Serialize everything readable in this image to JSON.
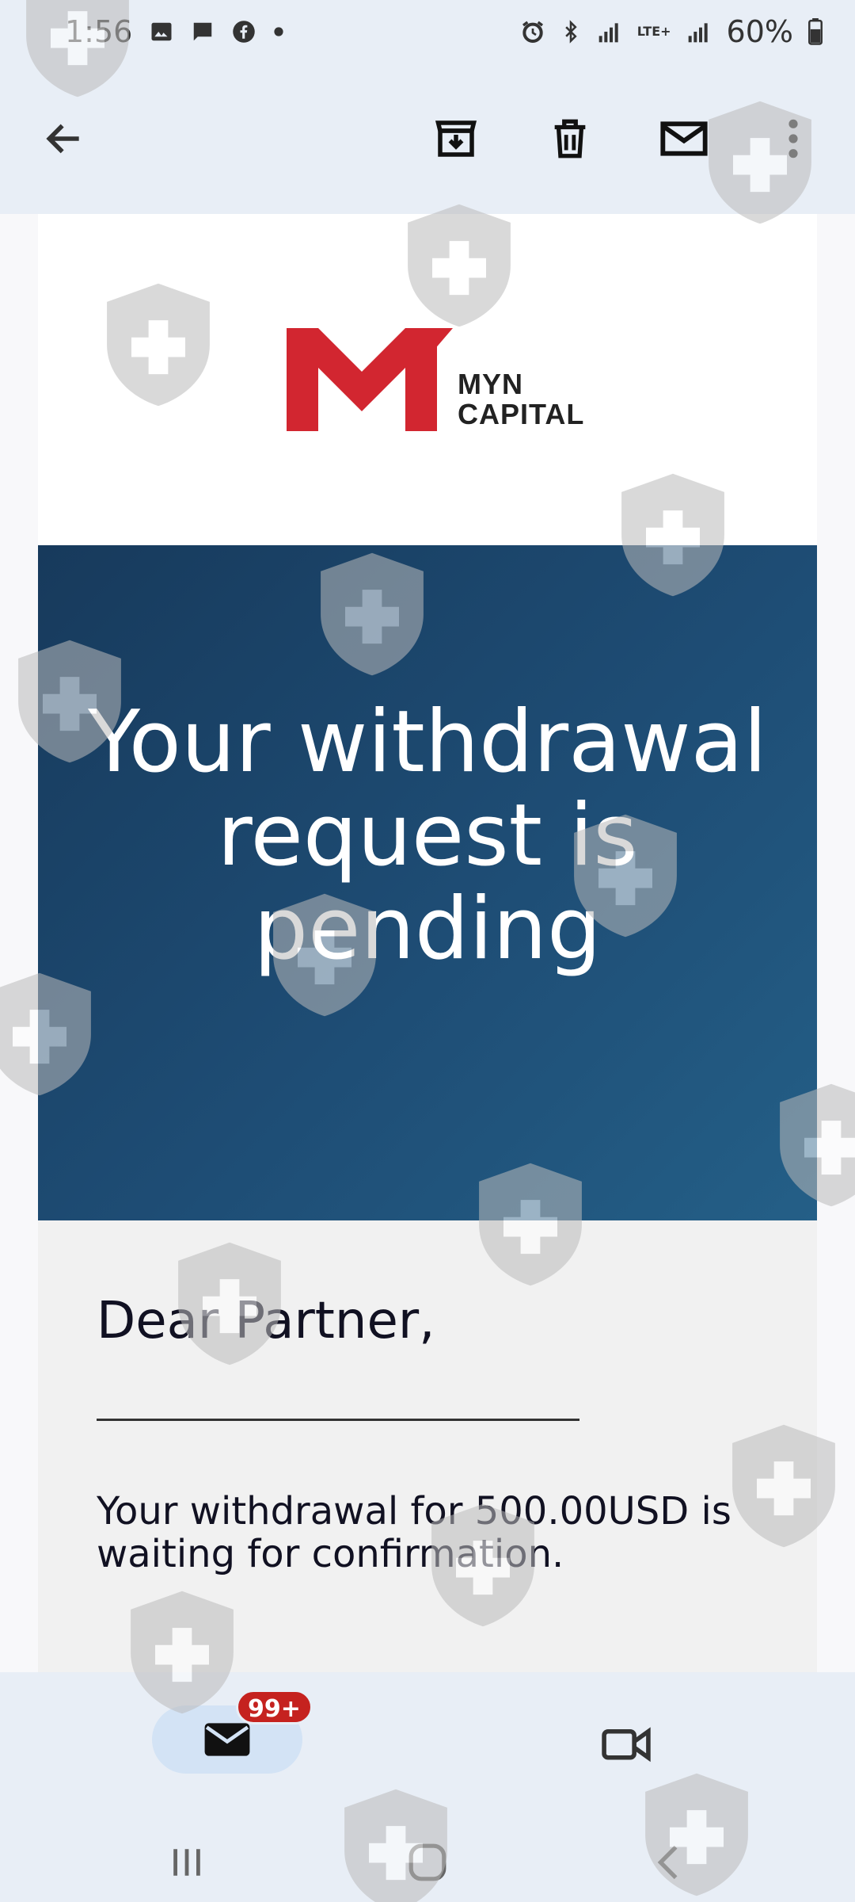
{
  "status_bar": {
    "time": "1:56",
    "network": "LTE+",
    "battery": "60%",
    "icons": [
      "image-icon",
      "message-icon",
      "facebook-icon",
      "dot-icon",
      "alarm-icon",
      "bluetooth-icon",
      "signal-icon",
      "signal-icon",
      "battery-icon"
    ]
  },
  "toolbar": {
    "icons": [
      "back-arrow-icon",
      "archive-icon",
      "delete-icon",
      "mark-unread-icon",
      "more-vert-icon"
    ]
  },
  "email": {
    "logo_line1": "MYN",
    "logo_line2": "CAPITAL",
    "logo_color": "#d22630",
    "hero_title": "Your withdrawal request is pending",
    "greeting": "Dear Partner,",
    "message": "Your withdrawal for 500.00USD is waiting for confirmation."
  },
  "bottom_nav": {
    "mail_badge": "99+",
    "icons": [
      "mail-icon",
      "video-icon"
    ]
  },
  "system_nav": {
    "icons": [
      "recent-apps-icon",
      "home-icon",
      "back-icon"
    ]
  },
  "colors": {
    "background": "#e8eef6",
    "hero_start": "#173a5c",
    "hero_end": "#245f87",
    "badge": "#c5221f",
    "mail_tab_active": "#d3e3f5"
  }
}
